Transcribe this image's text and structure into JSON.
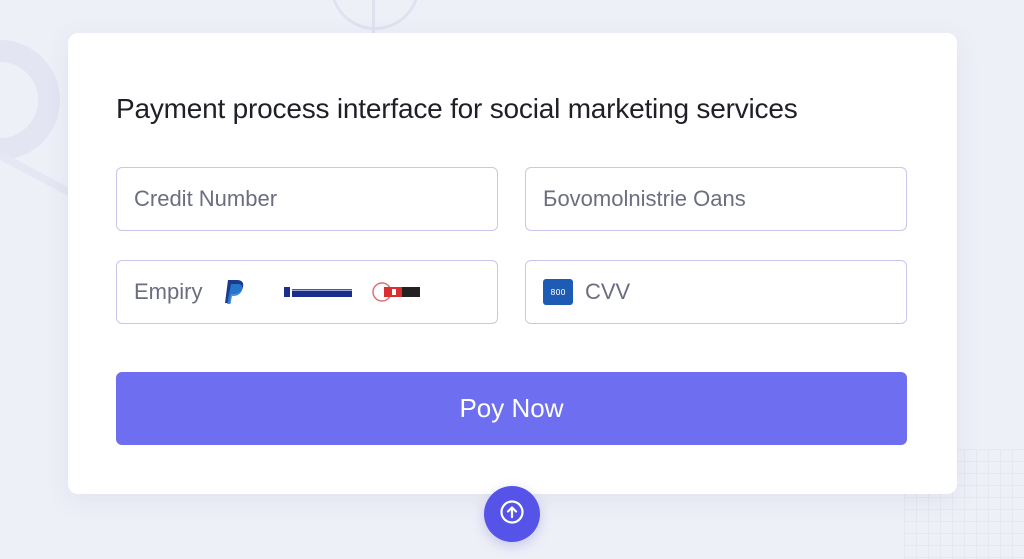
{
  "form": {
    "title": "Payment process interface for social marketing services",
    "credit_number_placeholder": "Credit Number",
    "cardholder_placeholder": "Бovomolnistrie Oans",
    "expiry_label": "Empiry",
    "cvv_label": "CVV",
    "cvv_icon_text": "800",
    "pay_button_label": "Poy Now"
  },
  "icons": {
    "paypal": "paypal-icon",
    "card_brand": "card-brand-icon",
    "mastercard": "mastercard-icon",
    "cvv": "cvv-card-icon",
    "upload": "arrow-up-circle-icon"
  },
  "colors": {
    "accent": "#6d6ef0",
    "fab": "#5553e8",
    "field_border": "#c9c6ec",
    "title": "#1f2027",
    "placeholder": "#6b6e80"
  }
}
